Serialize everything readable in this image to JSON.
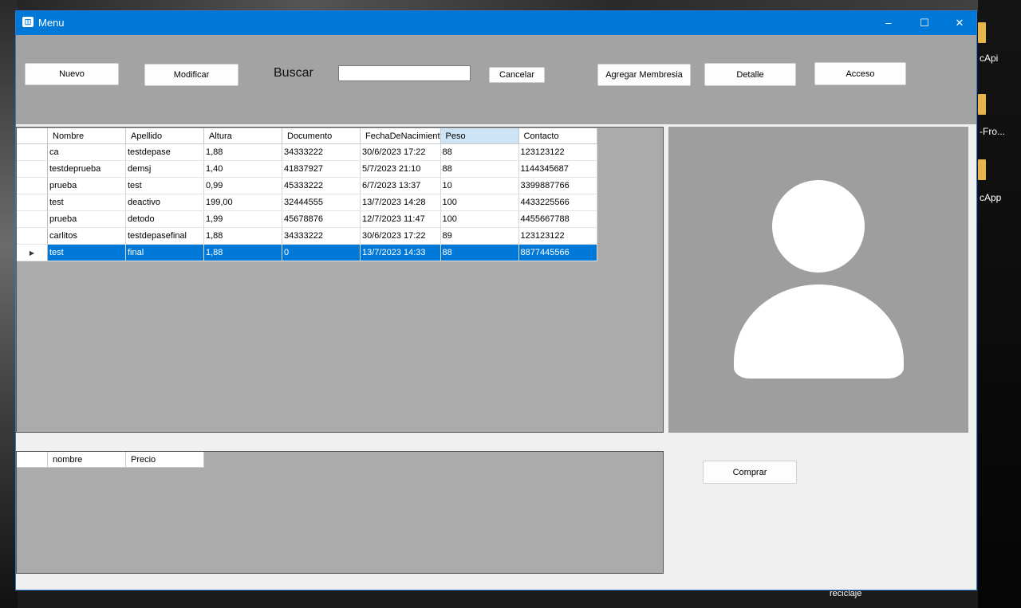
{
  "desktop": {
    "labels": [
      "cApi",
      "-Fro...",
      "cApp"
    ],
    "bottom_label": "reciclaje"
  },
  "window": {
    "title": "Menu",
    "controls": {
      "minimize": "–",
      "maximize": "☐",
      "close": "✕"
    }
  },
  "toolbar": {
    "nuevo": "Nuevo",
    "modificar": "Modificar",
    "buscar_label": "Buscar",
    "search_value": "",
    "cancelar": "Cancelar",
    "agregar_membresia": "Agregar Membresia",
    "detalle": "Detalle",
    "acceso": "Acceso"
  },
  "main_grid": {
    "columns": [
      "Nombre",
      "Apellido",
      "Altura",
      "Documento",
      "FechaDeNacimient",
      "Peso",
      "Contacto"
    ],
    "selected_column": 5,
    "rows": [
      [
        "ca",
        "testdepase",
        "1,88",
        "34333222",
        "30/6/2023 17:22",
        "88",
        "123123122"
      ],
      [
        "testdeprueba",
        "demsj",
        "1,40",
        "41837927",
        "5/7/2023 21:10",
        "88",
        "1144345687"
      ],
      [
        "prueba",
        "test",
        "0,99",
        "45333222",
        "6/7/2023 13:37",
        "10",
        "3399887766"
      ],
      [
        "test",
        "deactivo",
        "199,00",
        "32444555",
        "13/7/2023 14:28",
        "100",
        "4433225566"
      ],
      [
        "prueba",
        "detodo",
        "1,99",
        "45678876",
        "12/7/2023 11:47",
        "100",
        "4455667788"
      ],
      [
        "carlitos",
        "testdepasefinal",
        "1,88",
        "34333222",
        "30/6/2023 17:22",
        "89",
        "123123122"
      ],
      [
        "test",
        "final",
        "1,88",
        "0",
        "13/7/2023 14:33",
        "88",
        "8877445566"
      ]
    ],
    "selected_row": 6,
    "current_row_marker": "▶"
  },
  "membership_grid": {
    "columns": [
      "nombre",
      "Precio"
    ]
  },
  "comprar": "Comprar",
  "colors": {
    "titlebar": "#0078d7",
    "selection": "#0078d7",
    "panel_gray": "#a3a3a3"
  }
}
